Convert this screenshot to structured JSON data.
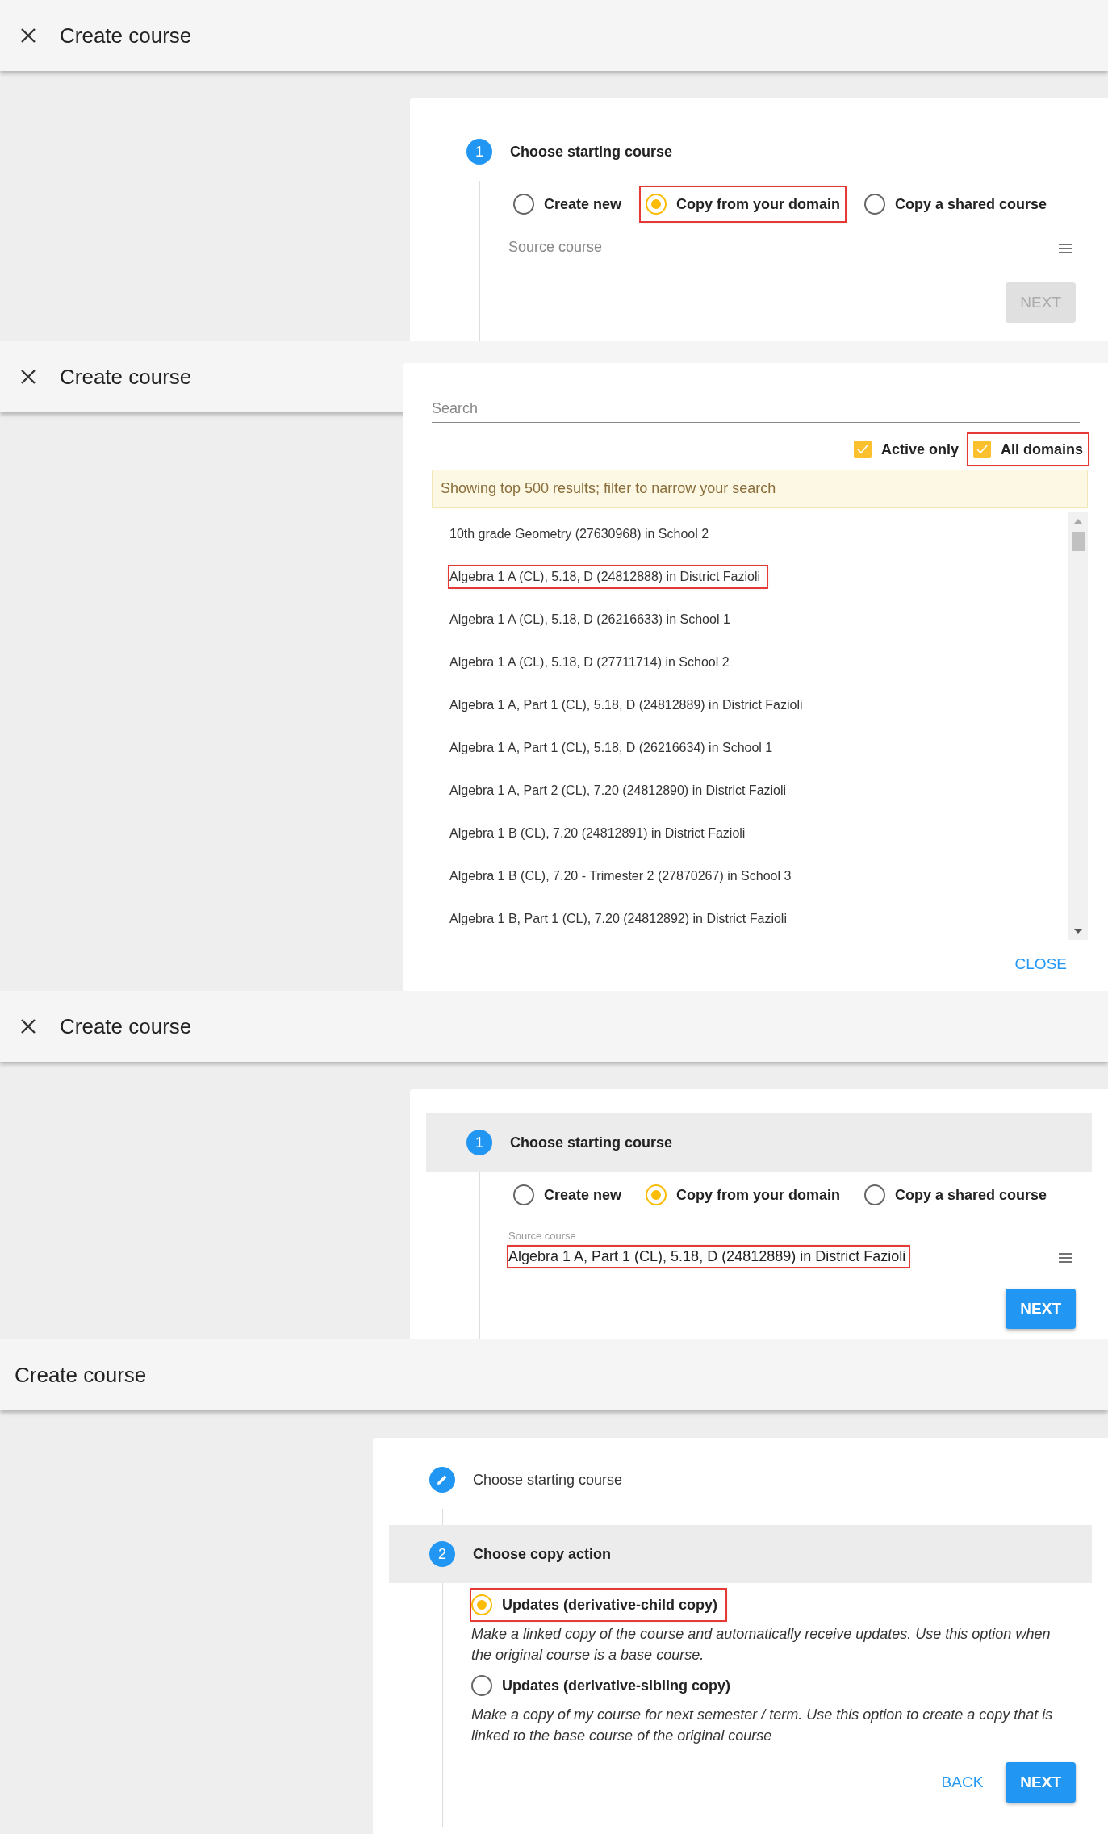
{
  "panels": [
    {
      "kind": "form",
      "title": "Create course",
      "closable": true,
      "steps": [
        {
          "number": "1",
          "label": "Choose starting course",
          "completed": false,
          "shaded": false
        }
      ],
      "options": [
        {
          "label": "Create new",
          "selected": false,
          "highlighted": false
        },
        {
          "label": "Copy from your domain",
          "selected": true,
          "highlighted": true
        },
        {
          "label": "Copy a shared course",
          "selected": false,
          "highlighted": false
        }
      ],
      "field": {
        "placeholder": "Source course"
      },
      "buttons": [
        {
          "label": "NEXT",
          "kind": "primary",
          "disabled": true
        }
      ]
    },
    {
      "kind": "dialog",
      "title": "Create course",
      "closable": true,
      "search": {
        "placeholder": "Search"
      },
      "filters": [
        {
          "label": "Active only",
          "checked": true,
          "highlighted": false
        },
        {
          "label": "All domains",
          "checked": true,
          "highlighted": true
        }
      ],
      "notice": "Showing top 500 results; filter to narrow your search",
      "results": [
        {
          "text": "10th grade Geometry (27630968) in School 2",
          "highlighted": false
        },
        {
          "text": "Algebra 1 A (CL), 5.18, D (24812888) in District Fazioli",
          "highlighted": true
        },
        {
          "text": "Algebra 1 A (CL), 5.18, D (26216633) in School 1",
          "highlighted": false
        },
        {
          "text": "Algebra 1 A (CL), 5.18, D (27711714) in School 2",
          "highlighted": false
        },
        {
          "text": "Algebra 1 A, Part 1 (CL), 5.18, D (24812889) in District Fazioli",
          "highlighted": false
        },
        {
          "text": "Algebra 1 A, Part 1 (CL), 5.18, D (26216634) in School 1",
          "highlighted": false
        },
        {
          "text": "Algebra 1 A, Part 2 (CL), 7.20 (24812890) in District Fazioli",
          "highlighted": false
        },
        {
          "text": "Algebra 1 B (CL), 7.20 (24812891) in District Fazioli",
          "highlighted": false
        },
        {
          "text": "Algebra 1 B (CL), 7.20 - Trimester 2 (27870267) in School 3",
          "highlighted": false
        },
        {
          "text": "Algebra 1 B, Part 1 (CL), 7.20 (24812892) in District Fazioli",
          "highlighted": false
        }
      ],
      "close_label": "CLOSE"
    },
    {
      "kind": "form",
      "title": "Create course",
      "closable": true,
      "steps": [
        {
          "number": "1",
          "label": "Choose starting course",
          "completed": false,
          "shaded": true
        }
      ],
      "options": [
        {
          "label": "Create new",
          "selected": false,
          "highlighted": false
        },
        {
          "label": "Copy from your domain",
          "selected": true,
          "highlighted": false
        },
        {
          "label": "Copy a shared course",
          "selected": false,
          "highlighted": false
        }
      ],
      "field": {
        "label": "Source course",
        "value": "Algebra 1 A, Part 1 (CL), 5.18, D (24812889) in District Fazioli",
        "highlighted": true
      },
      "buttons": [
        {
          "label": "NEXT",
          "kind": "primary",
          "disabled": false
        }
      ]
    },
    {
      "kind": "form",
      "title": "Create course",
      "closable": false,
      "steps": [
        {
          "label": "Choose starting course",
          "completed": true,
          "shaded": false
        },
        {
          "number": "2",
          "label": "Choose copy action",
          "completed": false,
          "shaded": true
        }
      ],
      "choices": [
        {
          "label": "Updates (derivative-child copy)",
          "description": "Make a linked copy of the course and automatically receive updates. Use this option when the original course is a base course.",
          "selected": true,
          "highlighted": true
        },
        {
          "label": "Updates (derivative-sibling copy)",
          "description": "Make a copy of my course for next semester / term. Use this option to create a copy that is linked to the base course of the original course",
          "selected": false,
          "highlighted": false
        }
      ],
      "buttons": [
        {
          "label": "BACK",
          "kind": "text"
        },
        {
          "label": "NEXT",
          "kind": "primary",
          "disabled": false
        }
      ]
    }
  ]
}
